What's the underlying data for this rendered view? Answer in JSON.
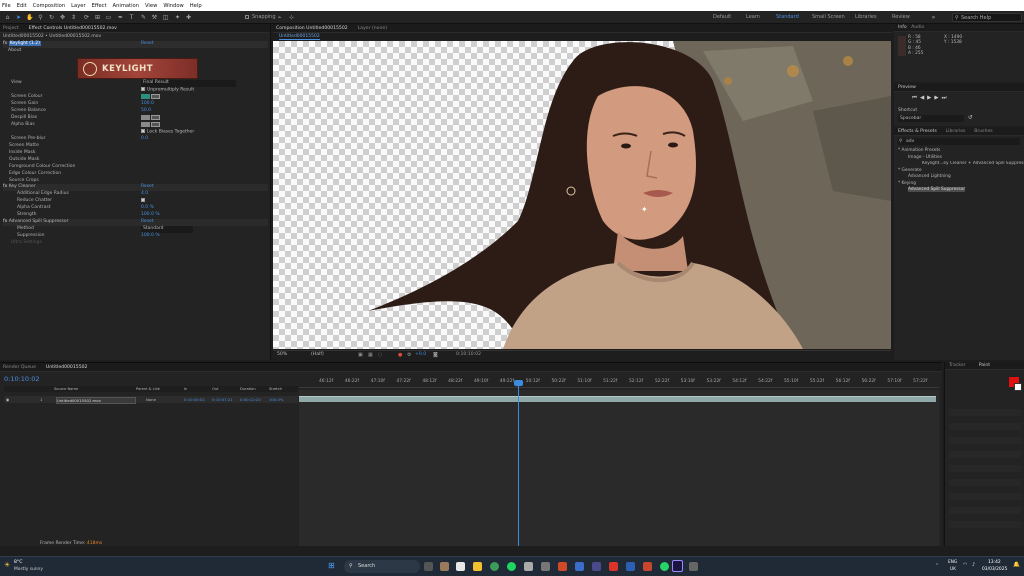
{
  "menu": [
    "File",
    "Edit",
    "Composition",
    "Layer",
    "Effect",
    "Animation",
    "View",
    "Window",
    "Help"
  ],
  "toolbar": {
    "snapping": "Snapping",
    "workspaces": [
      "Default",
      "Learn",
      "Standard",
      "Small Screen",
      "Libraries",
      "Review"
    ],
    "search_placeholder": "Search Help"
  },
  "left_panel": {
    "tabs": [
      "Project",
      "Effect Controls Untitled00015502.mov"
    ],
    "breadcrumb": "Untitled00015502 • Untitled00015502.mov",
    "effect_name": "Keylight (1.2)",
    "reset": "Reset",
    "about": "About",
    "logo_text": "KEYLIGHT",
    "rows": [
      {
        "label": "View",
        "value": "Final Result"
      },
      {
        "label": "",
        "value": "Unpremultiply Result"
      },
      {
        "label": "Screen Colour",
        "value": ""
      },
      {
        "label": "Screen Gain",
        "value": "100.0"
      },
      {
        "label": "Screen Balance",
        "value": "50.0"
      },
      {
        "label": "Despill Bias",
        "value": ""
      },
      {
        "label": "Alpha Bias",
        "value": ""
      },
      {
        "label": "",
        "value": "Lock Biases Together"
      },
      {
        "label": "Screen Pre-blur",
        "value": "0.0"
      },
      {
        "label": "Screen Matte",
        "value": ""
      },
      {
        "label": "Inside Mask",
        "value": ""
      },
      {
        "label": "Outside Mask",
        "value": ""
      },
      {
        "label": "Foreground Colour Correction",
        "value": ""
      },
      {
        "label": "Edge Colour Correction",
        "value": ""
      },
      {
        "label": "Source Crops",
        "value": ""
      }
    ],
    "key_cleaner": {
      "name": "Key Cleaner",
      "reset": "Reset",
      "rows": [
        {
          "label": "Additional Edge Radius",
          "value": "4.0"
        },
        {
          "label": "Reduce Chatter",
          "value": ""
        },
        {
          "label": "Alpha Contrast",
          "value": "0.0 %"
        },
        {
          "label": "Strength",
          "value": "100.0 %"
        }
      ]
    },
    "spill": {
      "name": "Advanced Spill Suppressor",
      "reset": "Reset",
      "rows": [
        {
          "label": "Method",
          "value": "Standard"
        },
        {
          "label": "Suppression",
          "value": "100.0 %"
        },
        {
          "label": "Ultra Settings",
          "value": ""
        }
      ]
    }
  },
  "composition": {
    "tab": "Composition Untitled00015502",
    "layer_tab": "Layer (none)",
    "subtab": "Untitled00015502",
    "zoom": "50%",
    "resolution": "(Half)",
    "timecode": "0:10:10:02",
    "exposure": "+0.0"
  },
  "right": {
    "info": {
      "tabs": [
        "Info",
        "Audio"
      ],
      "r": "R :",
      "g": "G :",
      "b": "B :",
      "a": "A :",
      "rv": "58",
      "gv": "45",
      "bv": "46",
      "av": "255",
      "x": "X : 1490",
      "y": "Y : 1538"
    },
    "preview": "Preview",
    "shortcut_label": "Shortcut",
    "shortcut_value": "Spacebar",
    "effects_tabs": [
      "Effects & Presets",
      "Libraries",
      "Brushes"
    ],
    "search": "adv",
    "tree": [
      "* Animation Presets",
      "Image - Utilities",
      "Keylight...ey Cleaner + Advanced Spill Suppressor",
      "* Generate",
      "Advanced Lightning",
      "* Keying",
      "Advanced Spill Suppressor"
    ]
  },
  "timeline": {
    "tabs": [
      "Render Queue",
      "Untitled00015502"
    ],
    "timecode": "0:10:10:02",
    "columns": [
      "Source Name",
      "Parent & Link",
      "In",
      "Out",
      "Duration",
      "Stretch"
    ],
    "layer": {
      "num": "1",
      "name": "Untitled00015502.mov",
      "parent": "None",
      "in": "0:10:45:02",
      "out": "0:10:57:21",
      "duration": "0:00:12:20",
      "stretch": "100.0%"
    },
    "ticks": [
      "46:12f",
      "46:22f",
      "47:10f",
      "47:22f",
      "48:12f",
      "48:22f",
      "49:10f",
      "49:22f",
      "50:12f",
      "50:22f",
      "51:10f",
      "51:22f",
      "52:12f",
      "52:22f",
      "53:10f",
      "53:22f",
      "54:12f",
      "54:22f",
      "55:10f",
      "55:22f",
      "56:12f",
      "56:22f",
      "57:10f",
      "57:22f"
    ],
    "render_time_label": "Frame Render Time:",
    "render_time": "418ms"
  },
  "paint": {
    "tabs": [
      "Tracker",
      "Paint"
    ]
  },
  "taskbar": {
    "weather_temp": "8°C",
    "weather_desc": "Mostly sunny",
    "search": "Search",
    "lang": "ENG",
    "region": "UK",
    "time": "13:42",
    "date": "03/03/2025"
  }
}
